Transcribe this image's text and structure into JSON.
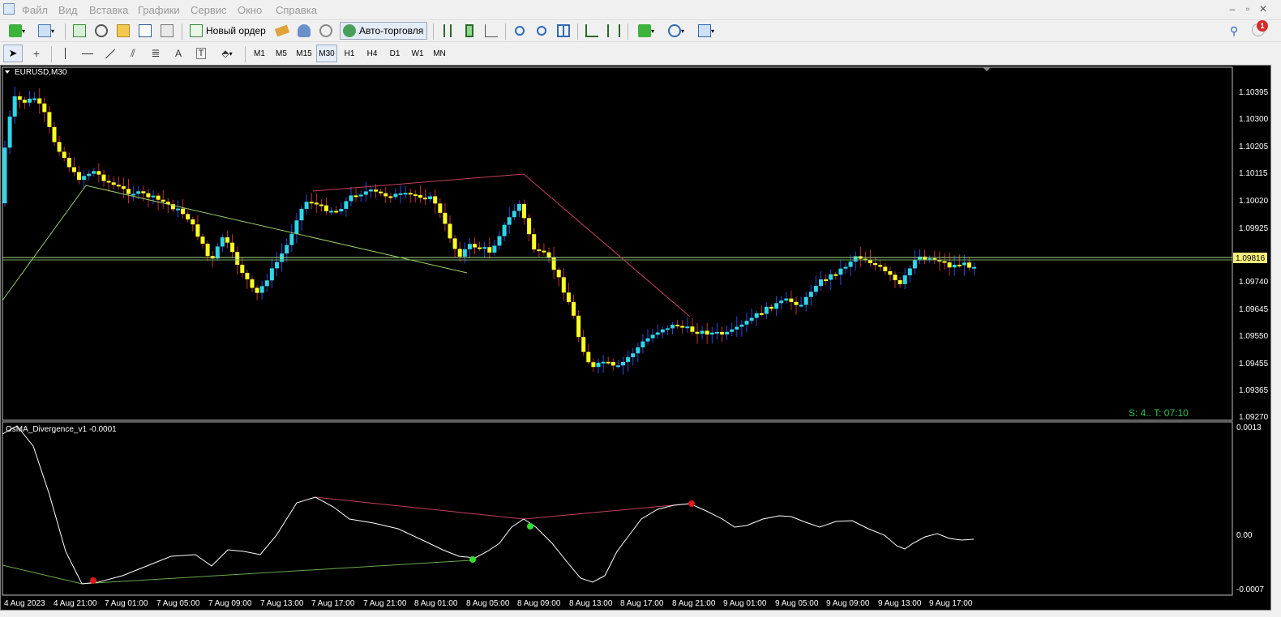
{
  "menu": [
    "Файл",
    "Вид",
    "Вставка",
    "Графики",
    "Сервис",
    "Окно",
    "Справка"
  ],
  "toolbar": {
    "new_order_label": "Новый ордер",
    "autotrading_label": "Авто-торговля",
    "notification_count": "1"
  },
  "timeframes": [
    "M1",
    "M5",
    "M15",
    "M30",
    "H1",
    "H4",
    "D1",
    "W1",
    "MN"
  ],
  "active_timeframe": "M30",
  "chart": {
    "title": "EURUSD,M30",
    "price_labels": [
      "1.10395",
      "1.10300",
      "1.10205",
      "1.10115",
      "1.10020",
      "1.09925",
      "1.09740",
      "1.09645",
      "1.09550",
      "1.09455",
      "1.09365",
      "1.09270"
    ],
    "current_price": "1.09816",
    "status_text": "S: 4.. T: 07:10",
    "colors": {
      "bull": "#2ed6e8",
      "bear": "#ffff22",
      "bid_line": "#aee08a",
      "status": "#2fc24a"
    }
  },
  "indicator": {
    "title": "OsMA_Divergence_v1 -0.0001",
    "scale_labels": [
      "0.0013",
      "0.00",
      "-0.0007"
    ]
  },
  "time_labels": [
    "4 Aug 2023",
    "4 Aug 21:00",
    "7 Aug 01:00",
    "7 Aug 05:00",
    "7 Aug 09:00",
    "7 Aug 13:00",
    "7 Aug 17:00",
    "7 Aug 21:00",
    "8 Aug 01:00",
    "8 Aug 05:00",
    "8 Aug 09:00",
    "8 Aug 13:00",
    "8 Aug 17:00",
    "8 Aug 21:00",
    "9 Aug 01:00",
    "9 Aug 05:00",
    "9 Aug 09:00",
    "9 Aug 13:00",
    "9 Aug 17:00"
  ]
}
